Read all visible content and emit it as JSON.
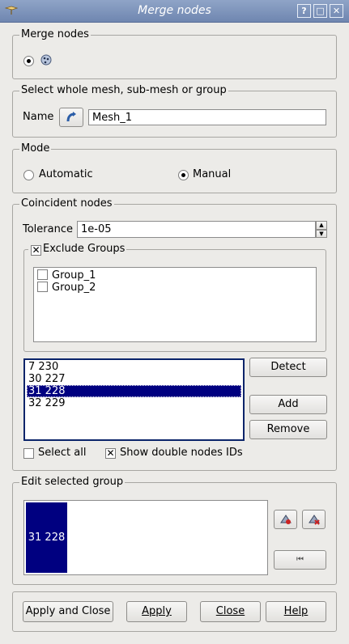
{
  "window": {
    "title": "Merge nodes"
  },
  "merge_nodes": {
    "group_title": "Merge nodes"
  },
  "mesh_select": {
    "group_title": "Select whole mesh, sub-mesh or group",
    "name_label": "Name",
    "name_value": "Mesh_1"
  },
  "mode": {
    "group_title": "Mode",
    "automatic_label": "Automatic",
    "manual_label": "Manual",
    "selected": "Manual"
  },
  "coincident": {
    "group_title": "Coincident nodes",
    "tolerance_label": "Tolerance",
    "tolerance_value": "1e-05",
    "exclude_groups_label": "Exclude Groups",
    "groups": [
      {
        "label": "Group_1"
      },
      {
        "label": "Group_2"
      }
    ],
    "node_pairs": [
      {
        "label": "7 230",
        "selected": false
      },
      {
        "label": "30 227",
        "selected": false
      },
      {
        "label": "31 228",
        "selected": true
      },
      {
        "label": "32 229",
        "selected": false
      }
    ],
    "detect_label": "Detect",
    "add_label": "Add",
    "remove_label": "Remove",
    "select_all_label": "Select all",
    "show_ids_label": "Show double nodes IDs"
  },
  "edit_group": {
    "group_title": "Edit selected group",
    "item": "31 228"
  },
  "footer": {
    "apply_close": "Apply and Close",
    "apply": "Apply",
    "close": "Close",
    "help": "Help"
  },
  "colors": {
    "selection": "#000080",
    "titlebar": "#7a8fb8"
  }
}
